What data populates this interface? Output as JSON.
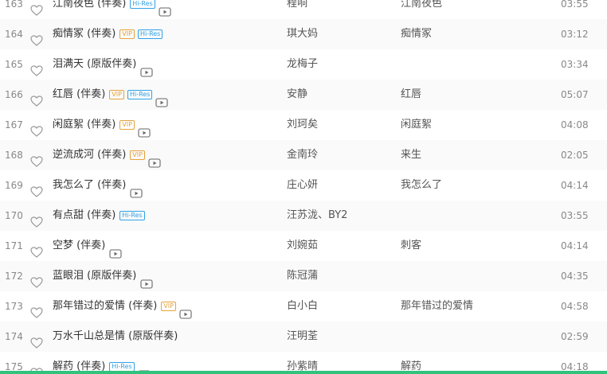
{
  "colors": {
    "vip": "#e6a23c",
    "hires": "#31a2e6",
    "accent": "#31c27c"
  },
  "icons": {
    "favorite": "heart-outline-icon",
    "mv": "play-video-icon"
  },
  "badges": {
    "vip": "VIP",
    "hires": "Hi-Res"
  },
  "songs": [
    {
      "num": "163",
      "title": "江南夜色 (伴奏)",
      "vip": false,
      "hires": true,
      "mv": true,
      "artist": "程响",
      "album": "江南夜色",
      "duration": "03:55"
    },
    {
      "num": "164",
      "title": "痴情冢 (伴奏)",
      "vip": true,
      "hires": true,
      "mv": false,
      "artist": "琪大妈",
      "album": "痴情冢",
      "duration": "03:12"
    },
    {
      "num": "165",
      "title": "泪满天 (原版伴奏)",
      "vip": false,
      "hires": false,
      "mv": true,
      "artist": "龙梅子",
      "album": "",
      "duration": "03:34"
    },
    {
      "num": "166",
      "title": "红唇 (伴奏)",
      "vip": true,
      "hires": true,
      "mv": true,
      "artist": "安静",
      "album": "红唇",
      "duration": "05:07"
    },
    {
      "num": "167",
      "title": "闲庭絮 (伴奏)",
      "vip": true,
      "hires": false,
      "mv": true,
      "artist": "刘珂矣",
      "album": "闲庭絮",
      "duration": "04:08"
    },
    {
      "num": "168",
      "title": "逆流成河 (伴奏)",
      "vip": true,
      "hires": false,
      "mv": true,
      "artist": "金南玲",
      "album": "来生",
      "duration": "02:05"
    },
    {
      "num": "169",
      "title": "我怎么了 (伴奏)",
      "vip": false,
      "hires": false,
      "mv": true,
      "artist": "庄心妍",
      "album": "我怎么了",
      "duration": "04:14"
    },
    {
      "num": "170",
      "title": "有点甜 (伴奏)",
      "vip": false,
      "hires": true,
      "mv": false,
      "artist": "汪苏泷、BY2",
      "album": "",
      "duration": "03:55"
    },
    {
      "num": "171",
      "title": "空梦 (伴奏)",
      "vip": false,
      "hires": false,
      "mv": true,
      "artist": "刘婉茹",
      "album": "刺客",
      "duration": "04:14"
    },
    {
      "num": "172",
      "title": "蓝眼泪 (原版伴奏)",
      "vip": false,
      "hires": false,
      "mv": true,
      "artist": "陈冠蒲",
      "album": "",
      "duration": "04:35"
    },
    {
      "num": "173",
      "title": "那年错过的爱情 (伴奏)",
      "vip": true,
      "hires": false,
      "mv": true,
      "artist": "白小白",
      "album": "那年错过的爱情",
      "duration": "04:58"
    },
    {
      "num": "174",
      "title": "万水千山总是情 (原版伴奏)",
      "vip": false,
      "hires": false,
      "mv": false,
      "artist": "汪明荃",
      "album": "",
      "duration": "02:59"
    },
    {
      "num": "175",
      "title": "解药 (伴奏)",
      "vip": false,
      "hires": true,
      "mv": true,
      "artist": "孙紫晴",
      "album": "解药",
      "duration": "04:18"
    }
  ]
}
